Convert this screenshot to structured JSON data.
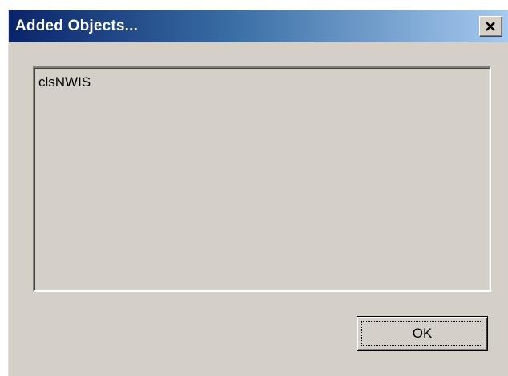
{
  "window": {
    "title": "Added Objects..."
  },
  "titlebar_buttons": {
    "close_icon": "close-x-icon"
  },
  "list": {
    "items": [
      "clsNWIS"
    ]
  },
  "buttons": {
    "ok_label": "OK"
  },
  "colors": {
    "titlebar_start": "#0a246a",
    "titlebar_end": "#a6caf0",
    "face": "#d4d0c8"
  }
}
